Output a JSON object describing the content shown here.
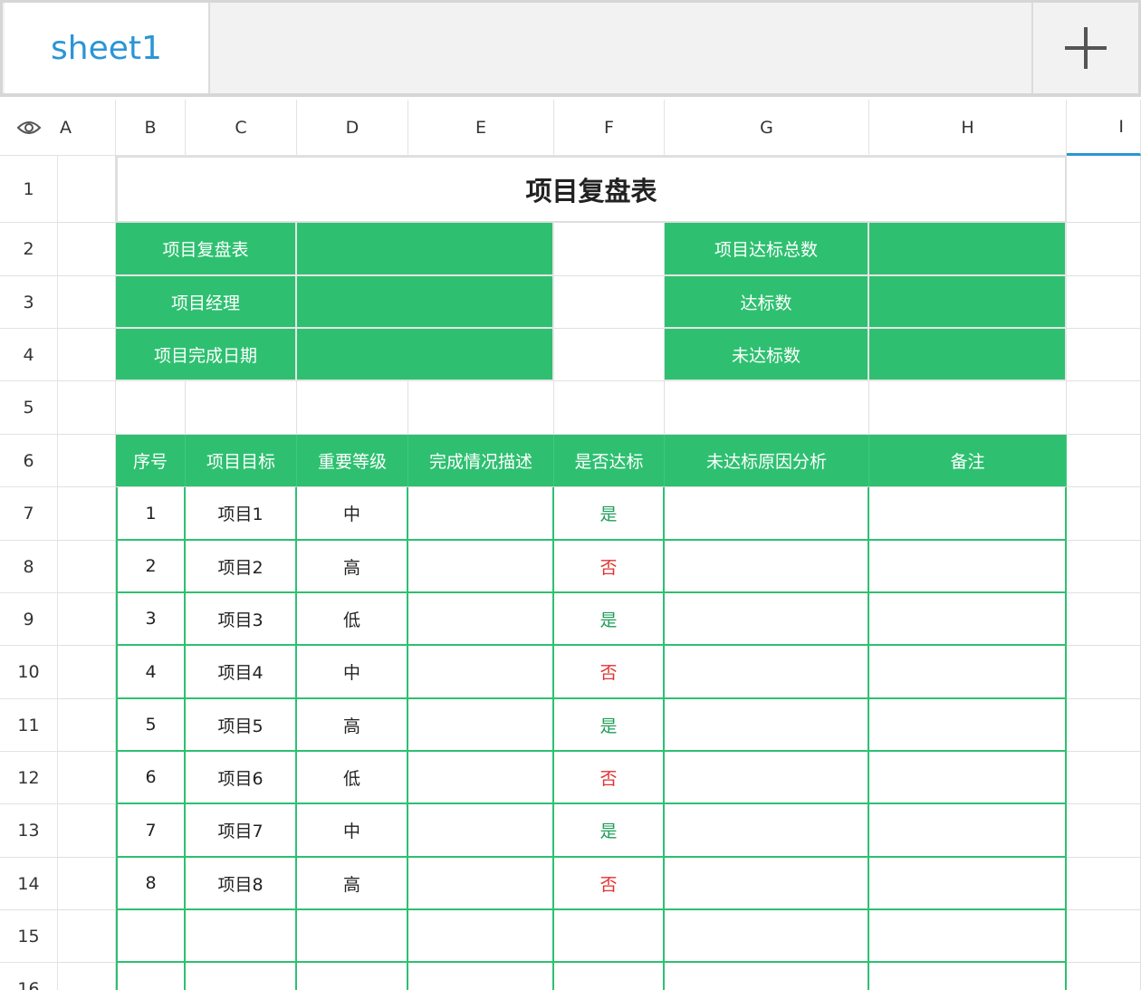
{
  "tabs": {
    "active_label": "sheet1",
    "add_icon": "plus-icon"
  },
  "header": {
    "toggle_icon": "eye-icon",
    "columns": [
      "A",
      "B",
      "C",
      "D",
      "E",
      "F",
      "G",
      "H",
      "I"
    ],
    "rows": [
      "1",
      "2",
      "3",
      "4",
      "5",
      "6",
      "7",
      "8",
      "9",
      "10",
      "11",
      "12",
      "13",
      "14",
      "15",
      "16"
    ]
  },
  "sheet": {
    "title": "项目复盘表",
    "info_left": [
      {
        "label": "项目复盘表",
        "value": ""
      },
      {
        "label": "项目经理",
        "value": ""
      },
      {
        "label": "项目完成日期",
        "value": ""
      }
    ],
    "info_right": [
      {
        "label": "项目达标总数",
        "value": ""
      },
      {
        "label": "达标数",
        "value": ""
      },
      {
        "label": "未达标数",
        "value": ""
      }
    ],
    "table_headers": [
      "序号",
      "项目目标",
      "重要等级",
      "完成情况描述",
      "是否达标",
      "未达标原因分析",
      "备注"
    ],
    "table_rows": [
      [
        "1",
        "项目1",
        "中",
        "",
        "是",
        "",
        ""
      ],
      [
        "2",
        "项目2",
        "高",
        "",
        "否",
        "",
        ""
      ],
      [
        "3",
        "项目3",
        "低",
        "",
        "是",
        "",
        ""
      ],
      [
        "4",
        "项目4",
        "中",
        "",
        "否",
        "",
        ""
      ],
      [
        "5",
        "项目5",
        "高",
        "",
        "是",
        "",
        ""
      ],
      [
        "6",
        "项目6",
        "低",
        "",
        "否",
        "",
        ""
      ],
      [
        "7",
        "项目7",
        "中",
        "",
        "是",
        "",
        ""
      ],
      [
        "8",
        "项目8",
        "高",
        "",
        "否",
        "",
        ""
      ]
    ],
    "status_colors": {
      "yes": "#1f9e58",
      "no": "#e0332f"
    },
    "accent_color": "#2ec070"
  }
}
